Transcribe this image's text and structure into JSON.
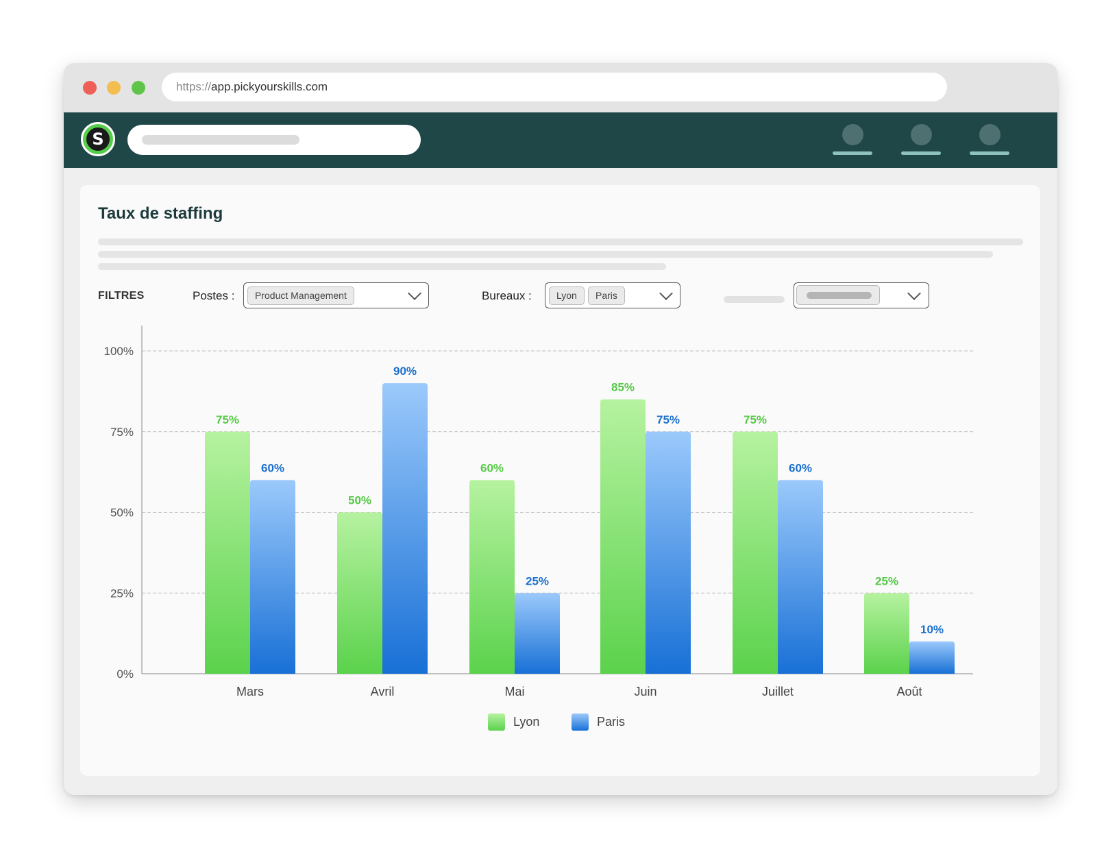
{
  "browser": {
    "url_protocol": "https://",
    "url_host": "app.pickyourskills.com"
  },
  "appbar": {
    "logo_letter": "S",
    "nav_items": [
      "nav-1",
      "nav-2",
      "nav-3"
    ]
  },
  "card": {
    "title": "Taux de staffing"
  },
  "filters": {
    "label": "FILTRES",
    "postes_label": "Postes :",
    "postes_chips": [
      "Product Management"
    ],
    "bureaux_label": "Bureaux :",
    "bureaux_chips": [
      "Lyon",
      "Paris"
    ]
  },
  "colors": {
    "lyon_top": "#b6f2a0",
    "lyon_bottom": "#5bd24c",
    "lyon_label": "#55c946",
    "paris_top": "#9bc9fb",
    "paris_bottom": "#1870d6",
    "paris_label": "#1a6fce",
    "header_bg": "#1f4747"
  },
  "chart_data": {
    "type": "bar",
    "categories": [
      "Mars",
      "Avril",
      "Mai",
      "Juin",
      "Juillet",
      "Août"
    ],
    "series": [
      {
        "name": "Lyon",
        "values": [
          75,
          50,
          60,
          85,
          75,
          25
        ]
      },
      {
        "name": "Paris",
        "values": [
          60,
          90,
          25,
          75,
          60,
          10
        ]
      }
    ],
    "value_labels": {
      "Lyon": [
        "75%",
        "50%",
        "60%",
        "85%",
        "75%",
        "25%"
      ],
      "Paris": [
        "60%",
        "90%",
        "25%",
        "75%",
        "60%",
        "10%"
      ]
    },
    "yticks": [
      "0%",
      "25%",
      "50%",
      "75%",
      "100%"
    ],
    "ylim": [
      0,
      100
    ],
    "grid": true,
    "legend_position": "bottom-center"
  }
}
